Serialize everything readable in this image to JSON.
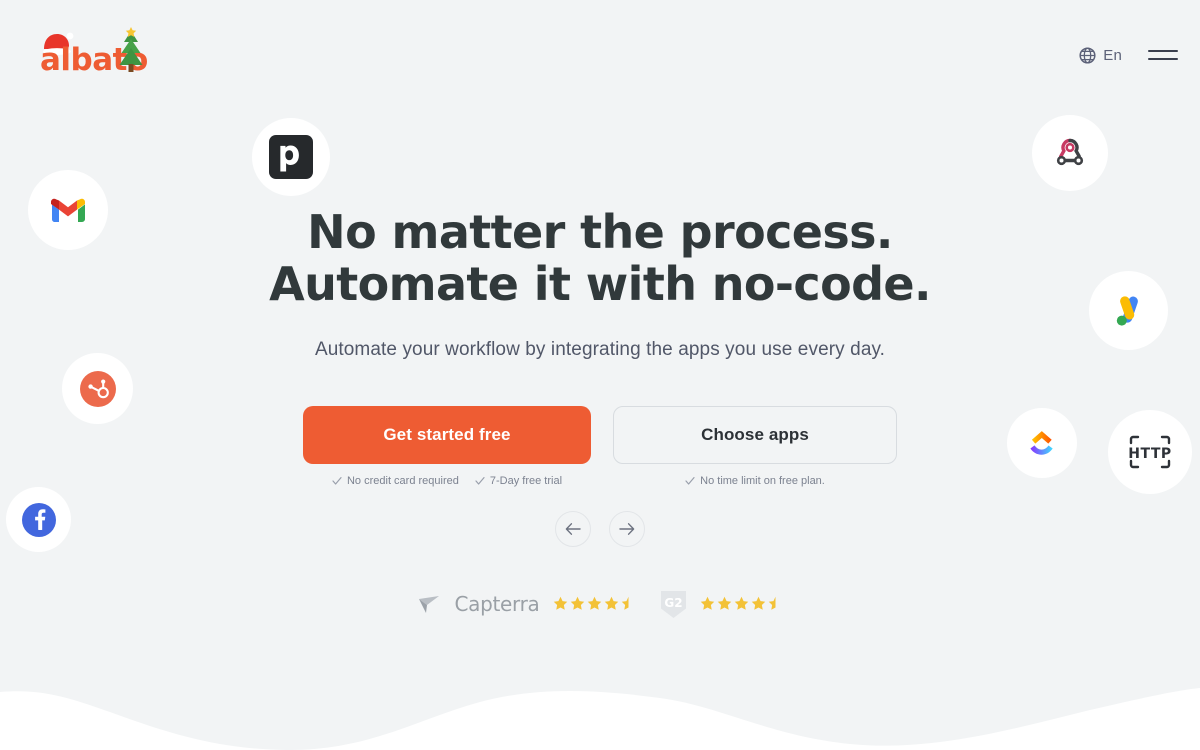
{
  "header": {
    "logo_text": "albato",
    "logo_decorations": [
      "santa-hat",
      "christmas-tree"
    ],
    "language_label": "En",
    "language_icon": "globe-icon",
    "menu_icon": "hamburger-menu-icon"
  },
  "hero": {
    "headline_line1": "No matter the process.",
    "headline_line2": "Automate it with no-code.",
    "subtitle": "Automate your workflow by integrating the apps you use every day.",
    "primary_cta": "Get started free",
    "secondary_cta": "Choose apps",
    "primary_notes": [
      "No credit card required",
      "7-Day free trial"
    ],
    "secondary_notes": [
      "No time limit on free plan."
    ],
    "prev_label": "←",
    "next_label": "→"
  },
  "ratings": [
    {
      "name": "Capterra",
      "label": "Capterra",
      "stars": 4.5
    },
    {
      "name": "G2",
      "label": "",
      "stars": 4.5
    }
  ],
  "app_bubbles": [
    {
      "name": "pipedrive",
      "label": "p"
    },
    {
      "name": "webhook",
      "label": ""
    },
    {
      "name": "gmail",
      "label": ""
    },
    {
      "name": "google-ads",
      "label": ""
    },
    {
      "name": "hubspot",
      "label": ""
    },
    {
      "name": "clickup",
      "label": ""
    },
    {
      "name": "http",
      "label": "HTTP"
    },
    {
      "name": "facebook",
      "label": "f"
    }
  ],
  "colors": {
    "brand_orange": "#ee5c33",
    "page_background": "#f2f4f5",
    "headline": "#31393b",
    "subtitle": "#515768",
    "note_text": "#7c8290",
    "star_gold": "#f3c237",
    "wave": "#ffffff"
  }
}
